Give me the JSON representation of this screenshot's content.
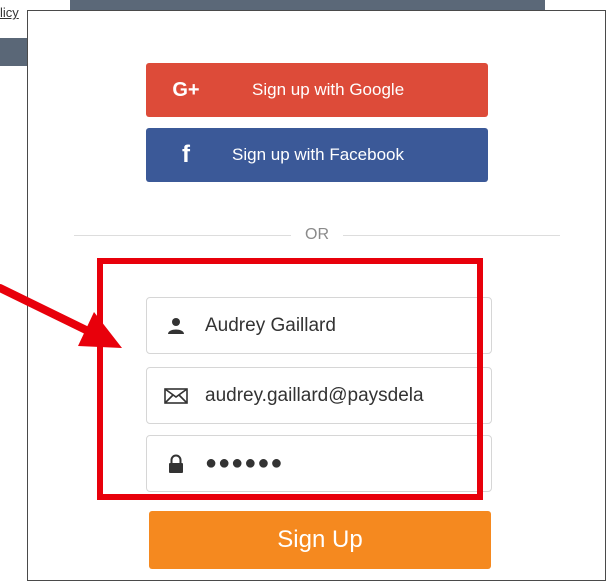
{
  "background": {
    "link_fragment": "licy"
  },
  "social": {
    "google_icon": "G+",
    "google_label": "Sign up with Google",
    "facebook_icon": "f",
    "facebook_label": "Sign up with Facebook"
  },
  "divider": {
    "or_text": "OR"
  },
  "form": {
    "name_value": "Audrey Gaillard",
    "email_value": "audrey.gaillard@paysdela",
    "password_value": "●●●●●●",
    "submit_label": "Sign Up"
  },
  "colors": {
    "google": "#dd4b39",
    "facebook": "#3b5998",
    "signup": "#f5891f",
    "highlight": "#e8000b"
  },
  "icons": {
    "name": "user-icon",
    "email": "envelope-icon",
    "password": "lock-icon"
  }
}
